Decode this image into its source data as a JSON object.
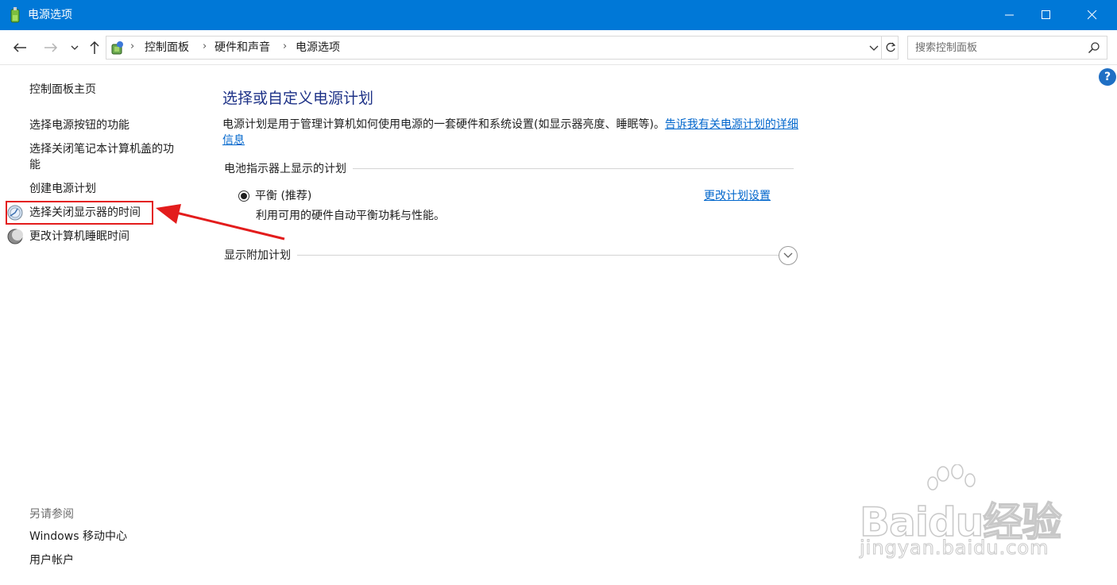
{
  "window": {
    "title": "电源选项"
  },
  "nav": {
    "breadcrumb": [
      "控制面板",
      "硬件和声音",
      "电源选项"
    ],
    "search_placeholder": "搜索控制面板"
  },
  "help": {
    "label": "?"
  },
  "sidebar": {
    "home": "控制面板主页",
    "links": [
      "选择电源按钮的功能",
      "选择关闭笔记本计算机盖的功",
      "能",
      "创建电源计划",
      "选择关闭显示器的时间",
      "更改计算机睡眠时间"
    ],
    "see_also_title": "另请参阅",
    "see_also": [
      "Windows 移动中心",
      "用户帐户"
    ]
  },
  "main": {
    "title": "选择或自定义电源计划",
    "description": "电源计划是用于管理计算机如何使用电源的一套硬件和系统设置(如显示器亮度、睡眠等)。",
    "description_link": "告诉我有关电源计划的详细信息",
    "battery_group_title": "电池指示器上显示的计划",
    "plan": {
      "name": "平衡 (推荐)",
      "description": "利用可用的硬件自动平衡功耗与性能。",
      "change_link": "更改计划设置",
      "selected": true
    },
    "additional_plans_title": "显示附加计划"
  },
  "watermark": {
    "logo": "Baidu经验",
    "url": "jingyan.baidu.com"
  },
  "colors": {
    "titlebar": "#0078d7",
    "link": "#0066cc",
    "heading": "#1e3287",
    "annotation": "#e31c1c"
  }
}
